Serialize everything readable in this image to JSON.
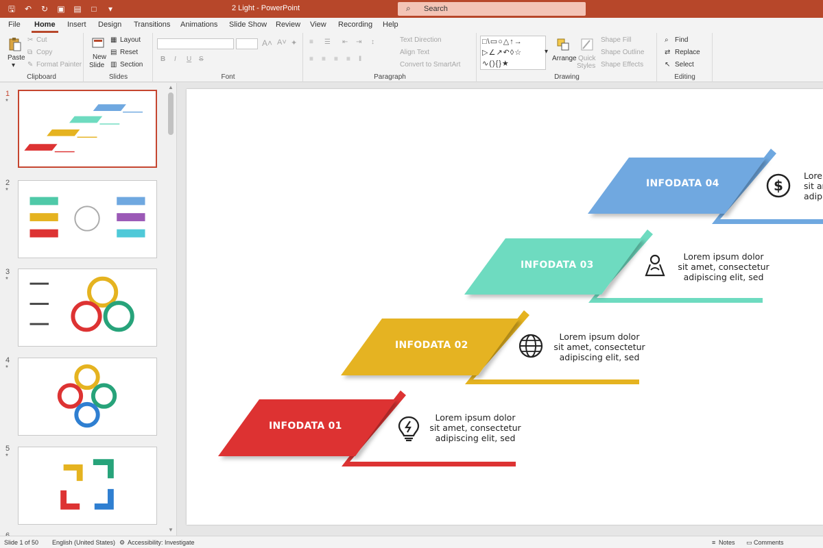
{
  "window": {
    "title": "2 Light  -  PowerPoint",
    "search_label": "Search"
  },
  "tabs": [
    "File",
    "Home",
    "Insert",
    "Design",
    "Transitions",
    "Animations",
    "Slide Show",
    "Review",
    "View",
    "Recording",
    "Help"
  ],
  "active_tab": "Home",
  "ribbon": {
    "clipboard": {
      "paste": "Paste",
      "cut": "Cut",
      "copy": "Copy",
      "format_painter": "Format Painter",
      "group": "Clipboard"
    },
    "slides": {
      "new_slide": "New",
      "new_slide2": "Slide",
      "layout": "Layout",
      "reset": "Reset",
      "section": "Section",
      "group": "Slides"
    },
    "font": {
      "bold": "B",
      "italic": "I",
      "underline": "U",
      "strike": "S",
      "group": "Font"
    },
    "paragraph": {
      "text_direction": "Text Direction",
      "align_text": "Align Text",
      "convert_smartart": "Convert to SmartArt",
      "group": "Paragraph"
    },
    "drawing": {
      "arrange": "Arrange",
      "quick_styles": "Quick",
      "quick_styles2": "Styles",
      "shape_fill": "Shape Fill",
      "shape_outline": "Shape Outline",
      "shape_effects": "Shape Effects",
      "group": "Drawing"
    },
    "editing": {
      "find": "Find",
      "replace": "Replace",
      "select": "Select",
      "group": "Editing"
    }
  },
  "thumbnails": [
    {
      "num": "1",
      "star": "*"
    },
    {
      "num": "2",
      "star": "*"
    },
    {
      "num": "3",
      "star": "*"
    },
    {
      "num": "4",
      "star": "*"
    },
    {
      "num": "5",
      "star": "*"
    },
    {
      "num": "6",
      "star": "*"
    }
  ],
  "slide": {
    "items": [
      {
        "label": "INFODATA 04",
        "color": "#6fa8e0",
        "l1": "Lore",
        "l2": "sit am",
        "l3": "adip",
        "icon": "dollar-icon"
      },
      {
        "label": "INFODATA 03",
        "color": "#6edbc0",
        "l1": "Lorem ipsum dolor",
        "l2": "sit amet, consectetur",
        "l3": "adipiscing elit, sed",
        "icon": "person-map-icon"
      },
      {
        "label": "INFODATA 02",
        "color": "#e5b320",
        "l1": "Lorem ipsum dolor",
        "l2": "sit amet, consectetur",
        "l3": "adipiscing elit, sed",
        "icon": "globe-icon"
      },
      {
        "label": "INFODATA 01",
        "color": "#dd3333",
        "l1": "Lorem ipsum dolor",
        "l2": "sit amet, consectetur",
        "l3": "adipiscing elit, sed",
        "icon": "lightbulb-icon"
      }
    ]
  },
  "status": {
    "slide_count": "Slide 1 of 50",
    "language": "English (United States)",
    "accessibility": "Accessibility: Investigate",
    "notes": "Notes",
    "comments": "Comments"
  }
}
